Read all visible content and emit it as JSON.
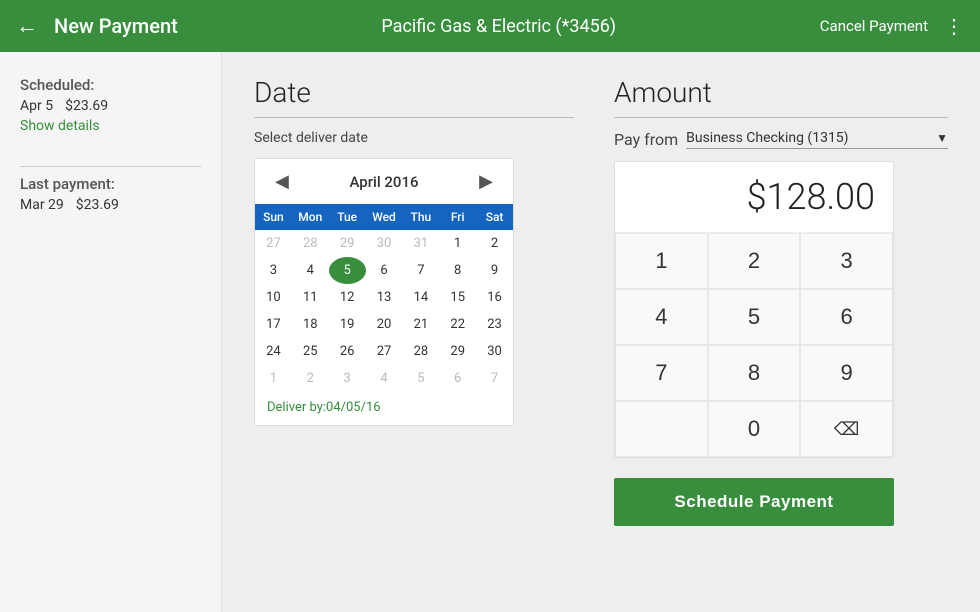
{
  "header": {
    "back_icon": "←",
    "title": "New Payment",
    "center_title": "Pacific Gas & Electric (*3456)",
    "cancel_label": "Cancel Payment",
    "more_icon": "⋮"
  },
  "sidebar": {
    "scheduled_label": "Scheduled:",
    "scheduled_date": "Apr 5",
    "scheduled_amount": "$23.69",
    "show_details_label": "Show details",
    "last_payment_label": "Last payment:",
    "last_payment_date": "Mar 29",
    "last_payment_amount": "$23.69"
  },
  "date_section": {
    "title": "Date",
    "select_label": "Select deliver date",
    "calendar": {
      "prev_icon": "◀",
      "next_icon": "▶",
      "month_year": "April 2016",
      "weekdays": [
        "Sun",
        "Mon",
        "Tue",
        "Wed",
        "Thu",
        "Fri",
        "Sat"
      ],
      "weeks": [
        [
          "27",
          "28",
          "29",
          "30",
          "31",
          "1",
          "2"
        ],
        [
          "3",
          "4",
          "5",
          "6",
          "7",
          "8",
          "9"
        ],
        [
          "10",
          "11",
          "12",
          "13",
          "14",
          "15",
          "16"
        ],
        [
          "17",
          "18",
          "19",
          "20",
          "21",
          "22",
          "23"
        ],
        [
          "24",
          "25",
          "26",
          "27",
          "28",
          "29",
          "30"
        ],
        [
          "1",
          "2",
          "3",
          "4",
          "5",
          "6",
          "7"
        ]
      ],
      "week0_other": [
        true,
        true,
        true,
        true,
        true,
        false,
        false
      ],
      "week1_other": [
        false,
        false,
        false,
        false,
        false,
        false,
        false
      ],
      "week2_other": [
        false,
        false,
        false,
        false,
        false,
        false,
        false
      ],
      "week3_other": [
        false,
        false,
        false,
        false,
        false,
        false,
        false
      ],
      "week4_other": [
        false,
        false,
        false,
        false,
        false,
        false,
        false
      ],
      "week5_other": [
        true,
        true,
        true,
        true,
        true,
        true,
        true
      ],
      "selected_week": 1,
      "selected_day_index": 2,
      "deliver_by": "Deliver by:04/05/16"
    }
  },
  "amount_section": {
    "title": "Amount",
    "pay_from_label": "Pay from",
    "account": "Business Checking (1315)",
    "amount_display": "$128.00",
    "numpad": {
      "buttons": [
        "1",
        "2",
        "3",
        "4",
        "5",
        "6",
        "7",
        "8",
        "9",
        "0",
        "⌫"
      ]
    },
    "schedule_button_label": "Schedule Payment"
  }
}
